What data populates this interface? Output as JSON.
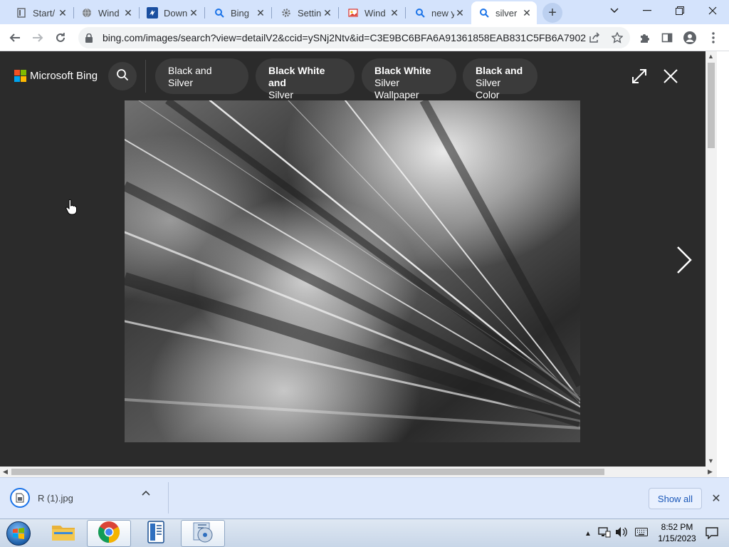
{
  "browser": {
    "tabs": [
      {
        "title": "Start/",
        "icon": "page-icon"
      },
      {
        "title": "Wind",
        "icon": "globe-icon"
      },
      {
        "title": "Down",
        "icon": "download-site-icon"
      },
      {
        "title": "Bing",
        "icon": "search-icon"
      },
      {
        "title": "Settin",
        "icon": "gear-icon"
      },
      {
        "title": "Wind",
        "icon": "image-site-icon"
      },
      {
        "title": "new y",
        "icon": "search-icon"
      },
      {
        "title": "silver",
        "icon": "search-icon",
        "active": true
      }
    ],
    "url": "bing.com/images/search?view=detailV2&ccid=ySNj2Ntv&id=C3E9BC6BFA6A91361858EAB831C5FB6A7902..."
  },
  "bing": {
    "brand": "Microsoft Bing",
    "chips": [
      {
        "line1": "Black and Silver",
        "line2": "",
        "bold": false
      },
      {
        "line1": "Black White and",
        "line2": "Silver",
        "bold": true
      },
      {
        "line1": "Black White",
        "line2": "Silver Wallpaper",
        "bold": true
      },
      {
        "line1": "Black and",
        "line2": "Silver Color",
        "bold": true
      }
    ]
  },
  "download_bar": {
    "file_name": "R (1).jpg",
    "show_all": "Show all"
  },
  "taskbar": {
    "time": "8:52 PM",
    "date": "1/15/2023"
  },
  "colors": {
    "viewer_bg": "#2b2b2b",
    "chip_bg": "#3b3b3b",
    "tabstrip_bg": "#d4e3fc",
    "download_bar_bg": "#dde8fb"
  }
}
